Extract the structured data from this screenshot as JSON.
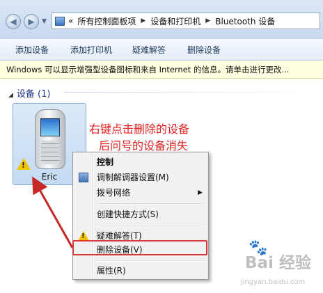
{
  "address_bar": {
    "back_icon": "arrow-left-icon",
    "forward_icon": "arrow-right-icon",
    "control_panel_icon": "control-panel-icon",
    "prefix": "«",
    "breadcrumbs": [
      "所有控制面板项",
      "设备和打印机",
      "Bluetooth 设备"
    ]
  },
  "toolbar": {
    "items": [
      "添加设备",
      "添加打印机",
      "疑难解答",
      "删除设备"
    ]
  },
  "info_bar": {
    "text": "Windows 可以显示增强型设备图标和来自 Internet 的信息。请单击进行更改..."
  },
  "group": {
    "title": "设备 (1)"
  },
  "device": {
    "name": "Eric",
    "icon": "mobile-phone-icon",
    "status_icon": "warning-icon"
  },
  "annotation": {
    "line1": "右键点击删除的设备",
    "line2": "后问号的设备消失",
    "color": "#e02020"
  },
  "context_menu": {
    "items": [
      {
        "label": "控制",
        "bold": true
      },
      {
        "label": "调制解调器设置(M)",
        "icon": "modem-icon"
      },
      {
        "label": "拨号网络",
        "submenu": true
      },
      {
        "label": "创建快捷方式(S)"
      },
      {
        "label": "疑难解答(T)",
        "icon": "warning-icon"
      },
      {
        "label": "删除设备(V)",
        "highlighted": true
      },
      {
        "label": "属性(R)"
      }
    ]
  },
  "watermark": {
    "main": "Bai 经验",
    "sub": "jingyan.baidu.com"
  }
}
